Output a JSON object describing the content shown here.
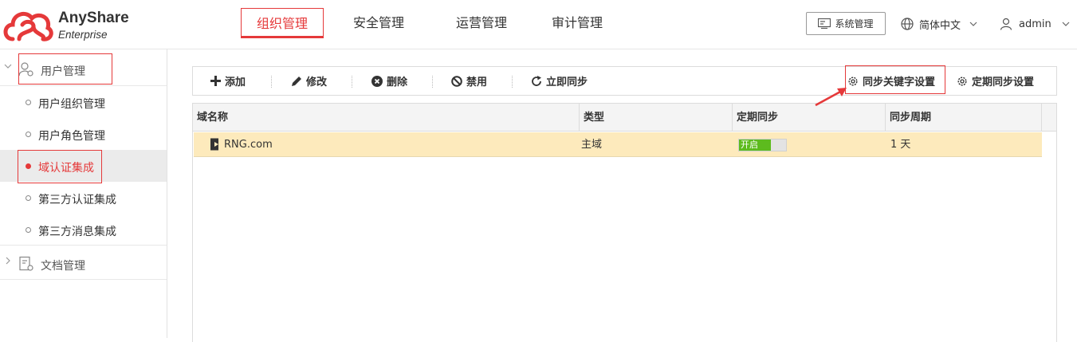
{
  "header": {
    "logo_name": "AnyShare",
    "logo_sub": "Enterprise",
    "nav": [
      "组织管理",
      "安全管理",
      "运营管理",
      "审计管理"
    ],
    "system_btn": "系统管理",
    "language": "简体中文",
    "user": "admin"
  },
  "sidebar": {
    "group1": "用户管理",
    "items": [
      "用户组织管理",
      "用户角色管理",
      "域认证集成",
      "第三方认证集成",
      "第三方消息集成"
    ],
    "group2": "文档管理"
  },
  "toolbar": {
    "add": "添加",
    "edit": "修改",
    "delete": "删除",
    "disable": "禁用",
    "sync_now": "立即同步",
    "sync_keyword": "同步关键字设置",
    "scheduled_sync": "定期同步设置"
  },
  "table": {
    "columns": [
      "域名称",
      "类型",
      "定期同步",
      "同步周期"
    ],
    "rows": [
      {
        "domain": "RNG.com",
        "type": "主域",
        "sync": "开启",
        "period": "1 天"
      }
    ]
  },
  "colors": {
    "accent": "#e5393a",
    "selected_row": "#fdeabc",
    "toggle_on": "#5dbb1e"
  }
}
